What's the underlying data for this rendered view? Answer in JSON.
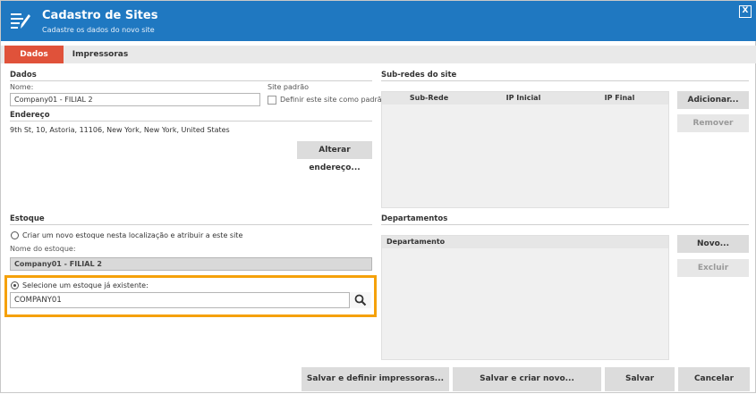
{
  "window": {
    "title": "Cadastro de Sites",
    "subtitle": "Cadastre os dados do novo site",
    "close_label": "X",
    "accent_color": "#1f78c1",
    "tab_accent_color": "#e0523a",
    "highlight_color": "#f5a10a"
  },
  "tabs": [
    {
      "label": "Dados",
      "active": true
    },
    {
      "label": "Impressoras",
      "active": false
    }
  ],
  "dados": {
    "section_title": "Dados",
    "nome_label": "Nome:",
    "nome_value": "Company01 - FILIAL 2",
    "site_padrao_label": "Site padrão",
    "definir_padrao_label": "Definir este site como padrão",
    "endereco_title": "Endereço",
    "endereco_value": "9th St, 10, Astoria, 11106, New York, New York, United States",
    "alterar_endereco_button": "Alterar endereço..."
  },
  "subredes": {
    "section_title": "Sub-redes do site",
    "columns": [
      "Sub-Rede",
      "IP Inicial",
      "IP Final"
    ],
    "adicionar_button": "Adicionar...",
    "remover_button": "Remover"
  },
  "estoque": {
    "section_title": "Estoque",
    "criar_option_label": "Criar um novo estoque nesta localização e atribuir a este site",
    "nome_estoque_label": "Nome do estoque:",
    "nome_estoque_value": "Company01 - FILIAL 2",
    "selecione_option_label": "Selecione um estoque já existente:",
    "selected_estoque_value": "COMPANY01",
    "search_icon": "magnifier"
  },
  "departamentos": {
    "section_title": "Departamentos",
    "columns": [
      "Departamento"
    ],
    "novo_button": "Novo...",
    "excluir_button": "Excluir"
  },
  "footer": {
    "salvar_definir_button": "Salvar e definir impressoras...",
    "salvar_criar_button": "Salvar e criar novo...",
    "salvar_button": "Salvar",
    "cancelar_button": "Cancelar"
  }
}
